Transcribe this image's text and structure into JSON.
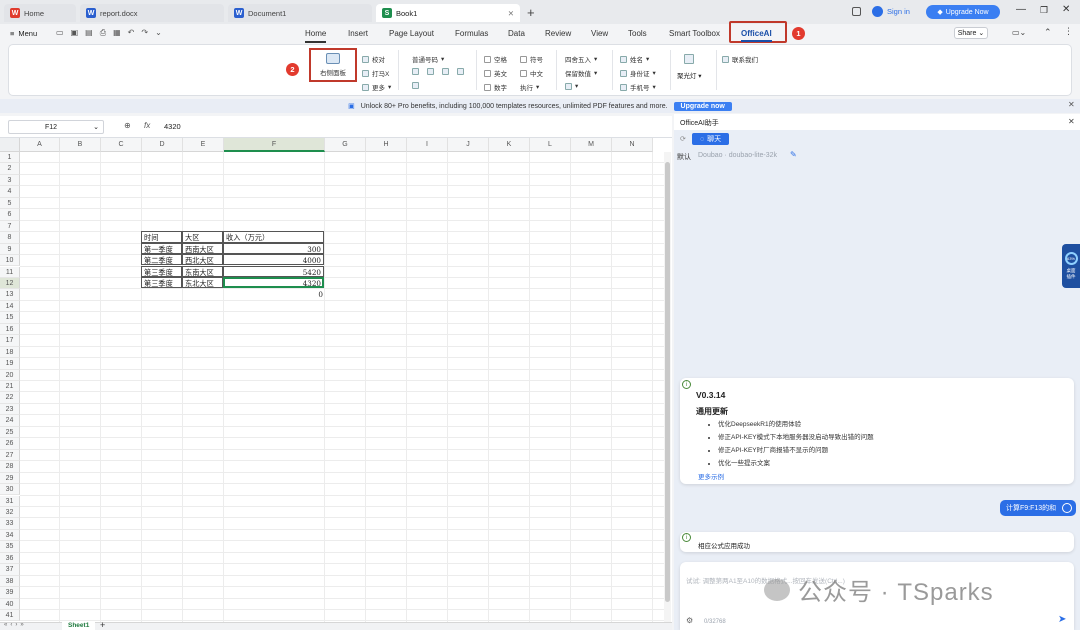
{
  "tabs": [
    {
      "label": "Home",
      "icon": "wps-icon"
    },
    {
      "label": "report.docx",
      "icon": "word-doc-icon"
    },
    {
      "label": "Document1",
      "icon": "word-doc-icon"
    },
    {
      "label": "Book1",
      "icon": "sheet-icon"
    }
  ],
  "titlebar": {
    "sign_in": "Sign in",
    "upgrade": "Upgrade Now"
  },
  "menu": {
    "menu_label": "Menu",
    "tabs": [
      "Home",
      "Insert",
      "Page Layout",
      "Formulas",
      "Data",
      "Review",
      "View",
      "Tools",
      "Smart Toolbox",
      "OfficeAI"
    ],
    "share": "Share"
  },
  "ribbon": {
    "open_panel": "右侧面板",
    "group1": [
      "校对",
      "打马X",
      "更多"
    ],
    "numfmt": "普通号码",
    "check1": [
      "空格",
      "英文",
      "数字"
    ],
    "check2": [
      "符号",
      "中文",
      "执行"
    ],
    "round": [
      "四舍五入",
      "保留数值"
    ],
    "id": [
      "姓名",
      "身份证",
      "手机号"
    ],
    "spotlight": "聚光灯",
    "contact": "联系我们"
  },
  "badges": [
    "1",
    "2"
  ],
  "promo": {
    "text": "Unlock 80+ Pro benefits, including 100,000 templates resources, unlimited PDF features and more.",
    "button": "Upgrade now"
  },
  "formula_bar": {
    "cell_ref": "F12",
    "fx": "fx",
    "value": "4320"
  },
  "columns": [
    "A",
    "B",
    "C",
    "D",
    "E",
    "F",
    "G",
    "H",
    "I",
    "J",
    "K",
    "L",
    "M",
    "N"
  ],
  "rows": [
    "1",
    "2",
    "3",
    "4",
    "5",
    "6",
    "7",
    "8",
    "9",
    "10",
    "11",
    "12",
    "13",
    "14",
    "15",
    "16",
    "17",
    "18",
    "19",
    "20",
    "21",
    "22",
    "23",
    "24",
    "25",
    "26",
    "27",
    "28",
    "29",
    "30",
    "31",
    "32",
    "33",
    "34",
    "35",
    "36",
    "37",
    "38",
    "39",
    "40",
    "41"
  ],
  "table": {
    "headers": [
      "时间",
      "大区",
      "收入（万元）"
    ],
    "rows": [
      [
        "第一季度",
        "西南大区",
        "300"
      ],
      [
        "第二季度",
        "西北大区",
        "4000"
      ],
      [
        "第三季度",
        "东南大区",
        "5420"
      ],
      [
        "第三季度",
        "东北大区",
        "4320"
      ]
    ],
    "sum": "0"
  },
  "sheet": {
    "name": "Sheet1"
  },
  "panel": {
    "title": "OfficeAI助手",
    "chat_tab": "聊天",
    "model_label": "默认",
    "model": "Doubao · doubao-lite-32k",
    "side_widget": "桌面插件",
    "side_pct": "63%",
    "version": "V0.3.14",
    "update_title": "通用更新",
    "updates": [
      "优化DeepseekR1的使用体验",
      "修正API-KEY模式下本地服务器没启动导致出错的问题",
      "修正API-KEY时厂商报错不显示的问题",
      "优化一些提示文案"
    ],
    "more": "更多示例",
    "user_msg": "计算F9:F13的和",
    "reply": "相应公式应用成功",
    "input_placeholder": "试试: 调整第两A1至A10的数据格式...按回车发送(Ctrl...)",
    "counter": "0/32768"
  },
  "watermark": "公众号 · TSparks",
  "colors": {
    "accent": "#2b6ee6",
    "badge": "#e23a2e",
    "highlight": "#c0392b"
  }
}
